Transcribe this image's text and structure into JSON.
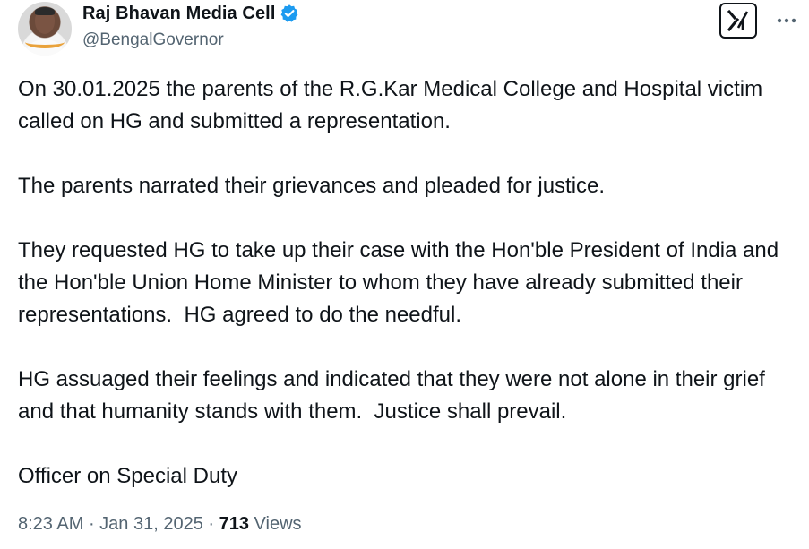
{
  "author": {
    "display_name": "Raj Bhavan Media Cell",
    "handle": "@BengalGovernor",
    "verified": true,
    "avatar_icon": "profile-photo"
  },
  "actions": {
    "grok_icon": "grok-icon",
    "more_icon": "more-options-icon"
  },
  "tweet": {
    "paragraphs": [
      "On 30.01.2025 the parents of the R.G.Kar Medical College and Hospital victim called on HG and submitted a representation.",
      "The parents narrated their grievances and pleaded for justice.",
      "They requested HG to take up their case with the Hon'ble President of India and the Hon'ble Union Home Minister to whom they have already submitted their representations.  HG agreed to do the needful.",
      "HG assuaged their feelings and indicated that they were not alone in their grief and that humanity stands with them.  Justice shall prevail.",
      "Officer on Special Duty"
    ]
  },
  "meta": {
    "time": "8:23 AM",
    "separator": " · ",
    "date": "Jan 31, 2025",
    "views_count": "713",
    "views_label": "Views"
  },
  "colors": {
    "text": "#0f1419",
    "secondary": "#536471",
    "verified_badge": "#1d9bf0"
  }
}
